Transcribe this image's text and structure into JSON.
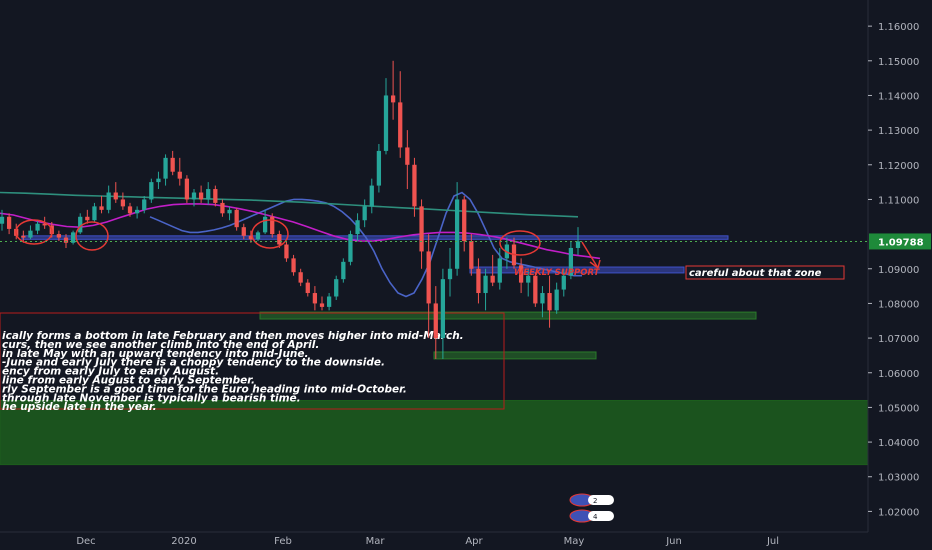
{
  "chart_data": {
    "type": "candlestick",
    "y_ticks": [
      1.02,
      1.03,
      1.04,
      1.05,
      1.06,
      1.07,
      1.08,
      1.09,
      1.1,
      1.11,
      1.12,
      1.13,
      1.14,
      1.15,
      1.16
    ],
    "y_tick_labels": [
      "1.02000",
      "1.03000",
      "1.04000",
      "1.05000",
      "1.06000",
      "1.07000",
      "1.08000",
      "1.09000",
      "1.10000",
      "1.11000",
      "1.12000",
      "1.13000",
      "1.14000",
      "1.15000",
      "1.16000"
    ],
    "ylim": [
      1.0155,
      1.1635
    ],
    "x_tick_labels": [
      "Dec",
      "2020",
      "Feb",
      "Mar",
      "Apr",
      "May",
      "Jun",
      "Jul"
    ],
    "current_price": {
      "value": 1.09788,
      "label": "1.09788"
    },
    "candles": [
      {
        "o": 1.103,
        "h": 1.107,
        "l": 1.101,
        "c": 1.105
      },
      {
        "o": 1.105,
        "h": 1.106,
        "l": 1.1,
        "c": 1.1015
      },
      {
        "o": 1.1015,
        "h": 1.103,
        "l": 1.0985,
        "c": 1.0995
      },
      {
        "o": 1.0995,
        "h": 1.101,
        "l": 1.0975,
        "c": 1.099
      },
      {
        "o": 1.099,
        "h": 1.1025,
        "l": 1.0985,
        "c": 1.101
      },
      {
        "o": 1.101,
        "h": 1.104,
        "l": 1.1,
        "c": 1.103
      },
      {
        "o": 1.103,
        "h": 1.105,
        "l": 1.1015,
        "c": 1.1025
      },
      {
        "o": 1.1025,
        "h": 1.1035,
        "l": 1.099,
        "c": 1.1
      },
      {
        "o": 1.1,
        "h": 1.101,
        "l": 1.098,
        "c": 1.099
      },
      {
        "o": 1.099,
        "h": 1.1,
        "l": 1.096,
        "c": 1.0975
      },
      {
        "o": 1.0975,
        "h": 1.101,
        "l": 1.097,
        "c": 1.1005
      },
      {
        "o": 1.1005,
        "h": 1.106,
        "l": 1.1,
        "c": 1.105
      },
      {
        "o": 1.105,
        "h": 1.107,
        "l": 1.103,
        "c": 1.104
      },
      {
        "o": 1.104,
        "h": 1.109,
        "l": 1.1035,
        "c": 1.108
      },
      {
        "o": 1.108,
        "h": 1.111,
        "l": 1.106,
        "c": 1.107
      },
      {
        "o": 1.107,
        "h": 1.114,
        "l": 1.106,
        "c": 1.112
      },
      {
        "o": 1.112,
        "h": 1.115,
        "l": 1.109,
        "c": 1.11
      },
      {
        "o": 1.11,
        "h": 1.112,
        "l": 1.107,
        "c": 1.108
      },
      {
        "o": 1.108,
        "h": 1.109,
        "l": 1.105,
        "c": 1.106
      },
      {
        "o": 1.106,
        "h": 1.108,
        "l": 1.1045,
        "c": 1.107
      },
      {
        "o": 1.107,
        "h": 1.111,
        "l": 1.106,
        "c": 1.11
      },
      {
        "o": 1.11,
        "h": 1.116,
        "l": 1.109,
        "c": 1.115
      },
      {
        "o": 1.115,
        "h": 1.118,
        "l": 1.113,
        "c": 1.116
      },
      {
        "o": 1.116,
        "h": 1.123,
        "l": 1.114,
        "c": 1.122
      },
      {
        "o": 1.122,
        "h": 1.124,
        "l": 1.117,
        "c": 1.118
      },
      {
        "o": 1.118,
        "h": 1.122,
        "l": 1.114,
        "c": 1.116
      },
      {
        "o": 1.116,
        "h": 1.117,
        "l": 1.109,
        "c": 1.11
      },
      {
        "o": 1.11,
        "h": 1.113,
        "l": 1.108,
        "c": 1.112
      },
      {
        "o": 1.112,
        "h": 1.114,
        "l": 1.109,
        "c": 1.11
      },
      {
        "o": 1.11,
        "h": 1.115,
        "l": 1.1085,
        "c": 1.113
      },
      {
        "o": 1.113,
        "h": 1.114,
        "l": 1.108,
        "c": 1.109
      },
      {
        "o": 1.109,
        "h": 1.11,
        "l": 1.105,
        "c": 1.106
      },
      {
        "o": 1.106,
        "h": 1.108,
        "l": 1.104,
        "c": 1.107
      },
      {
        "o": 1.107,
        "h": 1.1075,
        "l": 1.101,
        "c": 1.102
      },
      {
        "o": 1.102,
        "h": 1.103,
        "l": 1.0985,
        "c": 1.0995
      },
      {
        "o": 1.0995,
        "h": 1.101,
        "l": 1.0975,
        "c": 1.0985
      },
      {
        "o": 1.0985,
        "h": 1.101,
        "l": 1.098,
        "c": 1.1005
      },
      {
        "o": 1.1005,
        "h": 1.107,
        "l": 1.1,
        "c": 1.105
      },
      {
        "o": 1.105,
        "h": 1.106,
        "l": 1.099,
        "c": 1.1
      },
      {
        "o": 1.1,
        "h": 1.101,
        "l": 1.096,
        "c": 1.097
      },
      {
        "o": 1.097,
        "h": 1.098,
        "l": 1.092,
        "c": 1.093
      },
      {
        "o": 1.093,
        "h": 1.094,
        "l": 1.088,
        "c": 1.089
      },
      {
        "o": 1.089,
        "h": 1.09,
        "l": 1.085,
        "c": 1.086
      },
      {
        "o": 1.086,
        "h": 1.087,
        "l": 1.082,
        "c": 1.083
      },
      {
        "o": 1.083,
        "h": 1.085,
        "l": 1.078,
        "c": 1.08
      },
      {
        "o": 1.08,
        "h": 1.082,
        "l": 1.078,
        "c": 1.079
      },
      {
        "o": 1.079,
        "h": 1.083,
        "l": 1.078,
        "c": 1.082
      },
      {
        "o": 1.082,
        "h": 1.088,
        "l": 1.081,
        "c": 1.087
      },
      {
        "o": 1.087,
        "h": 1.093,
        "l": 1.086,
        "c": 1.092
      },
      {
        "o": 1.092,
        "h": 1.101,
        "l": 1.091,
        "c": 1.1
      },
      {
        "o": 1.1,
        "h": 1.106,
        "l": 1.098,
        "c": 1.104
      },
      {
        "o": 1.104,
        "h": 1.11,
        "l": 1.102,
        "c": 1.108
      },
      {
        "o": 1.108,
        "h": 1.116,
        "l": 1.106,
        "c": 1.114
      },
      {
        "o": 1.114,
        "h": 1.126,
        "l": 1.112,
        "c": 1.124
      },
      {
        "o": 1.124,
        "h": 1.145,
        "l": 1.123,
        "c": 1.14
      },
      {
        "o": 1.14,
        "h": 1.15,
        "l": 1.133,
        "c": 1.138
      },
      {
        "o": 1.138,
        "h": 1.147,
        "l": 1.122,
        "c": 1.125
      },
      {
        "o": 1.125,
        "h": 1.13,
        "l": 1.113,
        "c": 1.12
      },
      {
        "o": 1.12,
        "h": 1.122,
        "l": 1.105,
        "c": 1.108
      },
      {
        "o": 1.108,
        "h": 1.11,
        "l": 1.09,
        "c": 1.095
      },
      {
        "o": 1.095,
        "h": 1.1,
        "l": 1.07,
        "c": 1.08
      },
      {
        "o": 1.08,
        "h": 1.085,
        "l": 1.064,
        "c": 1.07
      },
      {
        "o": 1.07,
        "h": 1.09,
        "l": 1.064,
        "c": 1.087
      },
      {
        "o": 1.087,
        "h": 1.096,
        "l": 1.082,
        "c": 1.09
      },
      {
        "o": 1.09,
        "h": 1.115,
        "l": 1.088,
        "c": 1.11
      },
      {
        "o": 1.11,
        "h": 1.111,
        "l": 1.095,
        "c": 1.098
      },
      {
        "o": 1.098,
        "h": 1.1,
        "l": 1.088,
        "c": 1.09
      },
      {
        "o": 1.09,
        "h": 1.093,
        "l": 1.08,
        "c": 1.083
      },
      {
        "o": 1.083,
        "h": 1.09,
        "l": 1.078,
        "c": 1.088
      },
      {
        "o": 1.088,
        "h": 1.094,
        "l": 1.085,
        "c": 1.086
      },
      {
        "o": 1.086,
        "h": 1.096,
        "l": 1.084,
        "c": 1.093
      },
      {
        "o": 1.093,
        "h": 1.099,
        "l": 1.09,
        "c": 1.097
      },
      {
        "o": 1.097,
        "h": 1.099,
        "l": 1.09,
        "c": 1.091
      },
      {
        "o": 1.091,
        "h": 1.093,
        "l": 1.083,
        "c": 1.086
      },
      {
        "o": 1.086,
        "h": 1.09,
        "l": 1.082,
        "c": 1.088
      },
      {
        "o": 1.088,
        "h": 1.089,
        "l": 1.079,
        "c": 1.08
      },
      {
        "o": 1.08,
        "h": 1.085,
        "l": 1.076,
        "c": 1.083
      },
      {
        "o": 1.083,
        "h": 1.088,
        "l": 1.073,
        "c": 1.078
      },
      {
        "o": 1.078,
        "h": 1.086,
        "l": 1.077,
        "c": 1.084
      },
      {
        "o": 1.084,
        "h": 1.09,
        "l": 1.082,
        "c": 1.088
      },
      {
        "o": 1.088,
        "h": 1.098,
        "l": 1.087,
        "c": 1.096
      },
      {
        "o": 1.096,
        "h": 1.102,
        "l": 1.094,
        "c": 1.0979
      }
    ],
    "moving_averages": [
      {
        "name": "",
        "color": "#4a64c8",
        "values": [
          1.105,
          1.104,
          1.103,
          1.102,
          1.101,
          1.1005,
          1.1005,
          1.1008,
          1.1012,
          1.1018,
          1.1025,
          1.1035,
          1.1045,
          1.1055,
          1.1065,
          1.1075,
          1.1085,
          1.1095,
          1.11,
          1.11,
          1.1098,
          1.1095,
          1.109,
          1.108,
          1.1065,
          1.1045,
          1.102,
          1.099,
          1.095,
          1.09,
          1.086,
          1.083,
          1.082,
          1.083,
          1.087,
          1.092,
          1.099,
          1.106,
          1.111,
          1.112,
          1.11,
          1.106,
          1.101,
          1.096,
          1.093,
          1.092,
          1.0915,
          1.091,
          1.0905,
          1.09,
          1.0895,
          1.089,
          1.0885,
          1.088,
          1.088
        ]
      },
      {
        "name": "",
        "color": "#c21ec8",
        "values": [
          1.106,
          1.1055,
          1.1045,
          1.1035,
          1.1028,
          1.1022,
          1.102,
          1.1025,
          1.1035,
          1.1048,
          1.106,
          1.1072,
          1.108,
          1.1085,
          1.1087,
          1.1087,
          1.1085,
          1.108,
          1.1073,
          1.1065,
          1.1055,
          1.1045,
          1.1035,
          1.1022,
          1.1008,
          1.0995,
          1.0985,
          1.098,
          1.098,
          1.0985,
          1.0992,
          1.0998,
          1.1002,
          1.1005,
          1.1005,
          1.1003,
          1.0999,
          1.0993,
          1.0985,
          1.0975,
          1.0965,
          1.0955,
          1.0948,
          1.094,
          1.0935,
          1.093
        ]
      },
      {
        "name": "",
        "color": "#2e8f7d",
        "values": [
          1.112,
          1.1118,
          1.1115,
          1.1112,
          1.111,
          1.1108,
          1.1106,
          1.1104,
          1.1102,
          1.11,
          1.1098,
          1.1095,
          1.1092,
          1.1088,
          1.1084,
          1.108,
          1.1076,
          1.1072,
          1.1068,
          1.1064,
          1.106,
          1.1056,
          1.1053,
          1.105
        ]
      }
    ],
    "horizontal_zones": [
      {
        "top": 1.0995,
        "bottom": 1.0985,
        "color": "#3f51c8"
      },
      {
        "top": 1.0905,
        "bottom": 1.0888,
        "color": "#3f51c8"
      },
      {
        "top": 1.0775,
        "bottom": 1.0755,
        "color": "#2a7a2a"
      },
      {
        "top": 1.066,
        "bottom": 1.064,
        "color": "#2a7a2a"
      },
      {
        "top": 1.052,
        "bottom": 1.0335,
        "color": "#1d5e1d"
      }
    ],
    "annotations": {
      "note_lines": [
        "ically forms a bottom in late February and then moves higher into mid-March.",
        "curs, then we see another climb into the end of April.",
        "in late May with an upward tendency into mid-June.",
        "-June and early July there is a choppy tendency to the downside.",
        "ency from early July to early August.",
        "line from early August to early September.",
        "rly September is a good time for the Euro heading into mid-October.",
        "through late November is typically a bearish time.",
        "he upside late in the year."
      ],
      "callout": "careful about that zone",
      "support_label": "WEEKLY SUPPORT",
      "event_badges": [
        "2",
        "4"
      ]
    },
    "grid": false
  }
}
